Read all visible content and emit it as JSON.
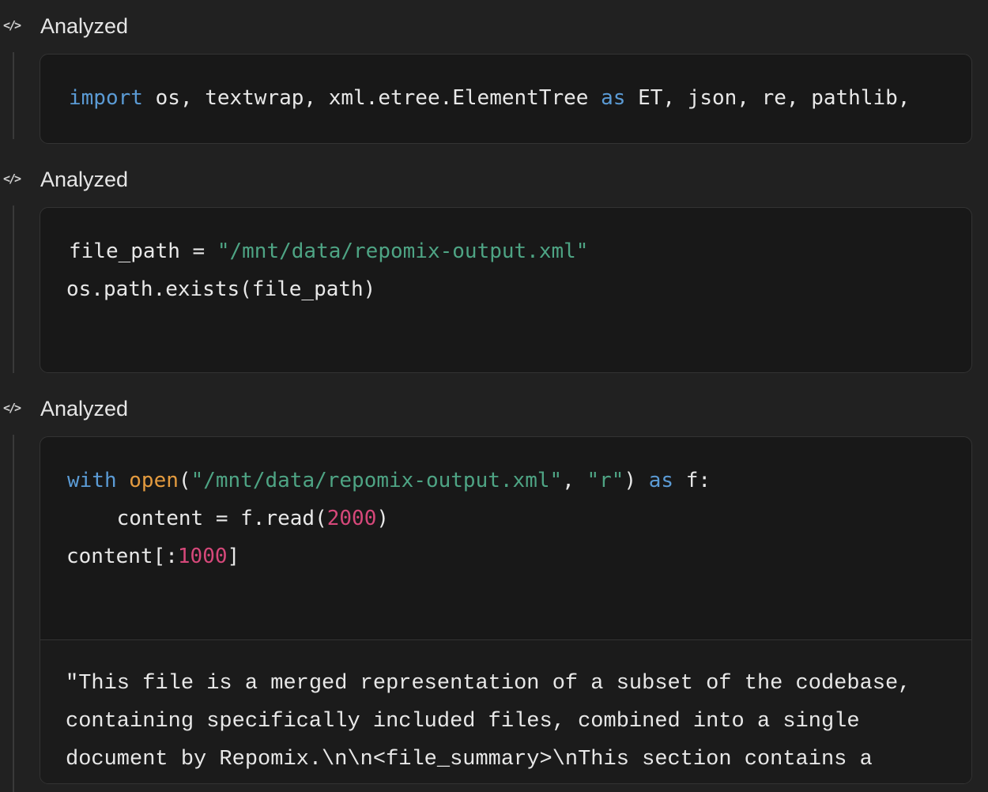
{
  "cells": [
    {
      "header": {
        "icon": "code-icon",
        "glyph": "</>",
        "label": "Analyzed"
      },
      "code": {
        "line1": {
          "t1": "import",
          "t2": " os, textwrap, xml.etree.ElementTree ",
          "t3": "as",
          "t4": " ET, json, re, pathlib,"
        }
      }
    },
    {
      "header": {
        "icon": "code-icon",
        "glyph": "</>",
        "label": "Analyzed"
      },
      "code": {
        "line1": {
          "t1": "file_path = ",
          "t2": "\"/mnt/data/repomix-output.xml\""
        },
        "line2": {
          "t1": "os.path.exists(file_path)"
        }
      }
    },
    {
      "header": {
        "icon": "code-icon",
        "glyph": "</>",
        "label": "Analyzed"
      },
      "code": {
        "line1": {
          "t1": "with",
          "t2": " ",
          "t3": "open",
          "t4": "(",
          "t5": "\"/mnt/data/repomix-output.xml\"",
          "t6": ", ",
          "t7": "\"r\"",
          "t8": ") ",
          "t9": "as",
          "t10": " f:"
        },
        "line2": {
          "t1": "    content = f.read(",
          "t2": "2000",
          "t3": ")"
        },
        "line3": {
          "t1": "content[:",
          "t2": "1000",
          "t3": "]"
        }
      },
      "output": {
        "lines": [
          "\"This file is a merged representation of a subset of the codebase,",
          "containing specifically included files, combined into a single",
          "document by Repomix.\\n\\n<file_summary>\\nThis section contains a"
        ]
      }
    }
  ],
  "colors": {
    "background": "#212121",
    "code_background": "#181818",
    "keyword": "#5b9bd5",
    "string": "#4ea484",
    "function": "#e49b3f",
    "number": "#d6487a"
  }
}
